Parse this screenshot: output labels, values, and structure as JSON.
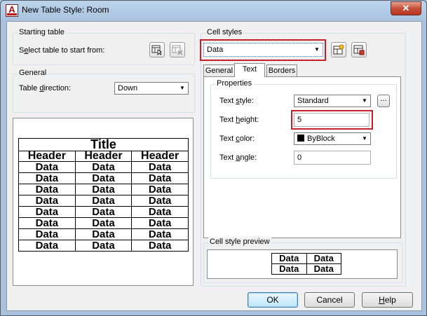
{
  "window": {
    "title": "New Table Style: Room",
    "close_glyph": "✕",
    "icon_letter": "A"
  },
  "starting_table": {
    "group_label": "Starting table",
    "select_label_prefix": "S",
    "select_label_underlined": "e",
    "select_label_rest": "lect table to start from:"
  },
  "general": {
    "group_label": "General",
    "direction_label_prefix": "Table ",
    "direction_label_underlined": "d",
    "direction_label_rest": "irection:",
    "direction_value": "Down"
  },
  "table_preview": {
    "title": "Title",
    "headers": [
      "Header",
      "Header",
      "Header"
    ],
    "rows": [
      [
        "Data",
        "Data",
        "Data"
      ],
      [
        "Data",
        "Data",
        "Data"
      ],
      [
        "Data",
        "Data",
        "Data"
      ],
      [
        "Data",
        "Data",
        "Data"
      ],
      [
        "Data",
        "Data",
        "Data"
      ],
      [
        "Data",
        "Data",
        "Data"
      ],
      [
        "Data",
        "Data",
        "Data"
      ],
      [
        "Data",
        "Data",
        "Data"
      ]
    ]
  },
  "cell_styles": {
    "group_label": "Cell styles",
    "selected": "Data",
    "tabs": [
      "General",
      "Text",
      "Borders"
    ],
    "active_tab": "Text",
    "properties_label": "Properties",
    "text_style_label_prefix": "Text ",
    "text_style_label_underlined": "s",
    "text_style_label_rest": "tyle:",
    "text_style_value": "Standard",
    "browse_label": "...",
    "text_height_label_prefix": "Text ",
    "text_height_label_underlined": "h",
    "text_height_label_rest": "eight:",
    "text_height_value": "5",
    "text_color_label_prefix": "Text ",
    "text_color_label_underlined": "c",
    "text_color_label_rest": "olor:",
    "text_color_value": "ByBlock",
    "text_angle_label_prefix": "Text ",
    "text_angle_label_underlined": "a",
    "text_angle_label_rest": "ngle:",
    "text_angle_value": "0"
  },
  "cell_style_preview": {
    "group_label": "Cell style preview",
    "rows": [
      [
        "Data",
        "Data"
      ],
      [
        "Data",
        "Data"
      ]
    ]
  },
  "buttons": {
    "ok": "OK",
    "cancel": "Cancel",
    "help_underlined": "H",
    "help_rest": "elp"
  },
  "colors": {
    "highlight": "#c4202a",
    "swatch": "#000000"
  }
}
